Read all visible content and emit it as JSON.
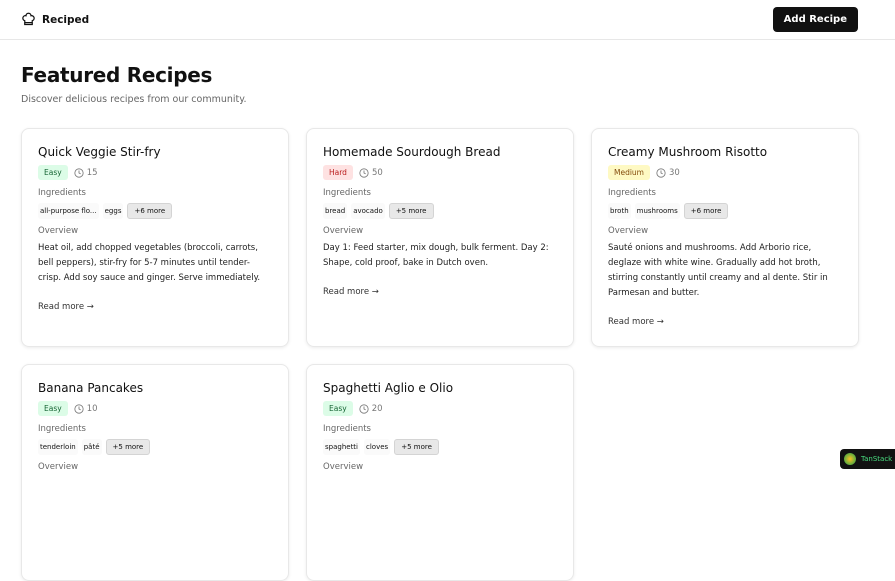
{
  "header": {
    "brand": "Reciped",
    "add_recipe": "Add Recipe"
  },
  "page": {
    "title": "Featured Recipes",
    "subtitle": "Discover delicious recipes from our community."
  },
  "labels": {
    "ingredients": "Ingredients",
    "overview": "Overview",
    "read_more": "Read more →"
  },
  "recipes": [
    {
      "title": "Quick Veggie Stir-fry",
      "difficulty": "Easy",
      "time": "15",
      "ingredients": [
        "all-purpose flo...",
        "eggs"
      ],
      "more": "+6 more",
      "overview": "Heat oil, add chopped vegetables (broccoli, carrots, bell peppers), stir-fry for 5-7 minutes until tender-crisp. Add soy sauce and ginger. Serve immediately."
    },
    {
      "title": "Homemade Sourdough Bread",
      "difficulty": "Hard",
      "time": "50",
      "ingredients": [
        "bread",
        "avocado"
      ],
      "more": "+5 more",
      "overview": "Day 1: Feed starter, mix dough, bulk ferment. Day 2: Shape, cold proof, bake in Dutch oven."
    },
    {
      "title": "Creamy Mushroom Risotto",
      "difficulty": "Medium",
      "time": "30",
      "ingredients": [
        "broth",
        "mushrooms"
      ],
      "more": "+6 more",
      "overview": "Sauté onions and mushrooms. Add Arborio rice, deglaze with white wine. Gradually add hot broth, stirring constantly until creamy and al dente. Stir in Parmesan and butter."
    },
    {
      "title": "Banana Pancakes",
      "difficulty": "Easy",
      "time": "10",
      "ingredients": [
        "tenderloin",
        "pâté"
      ],
      "more": "+5 more",
      "overview": ""
    },
    {
      "title": "Spaghetti Aglio e Olio",
      "difficulty": "Easy",
      "time": "20",
      "ingredients": [
        "spaghetti",
        "cloves"
      ],
      "more": "+5 more",
      "overview": ""
    }
  ],
  "devtools": {
    "label": "TanStack"
  }
}
